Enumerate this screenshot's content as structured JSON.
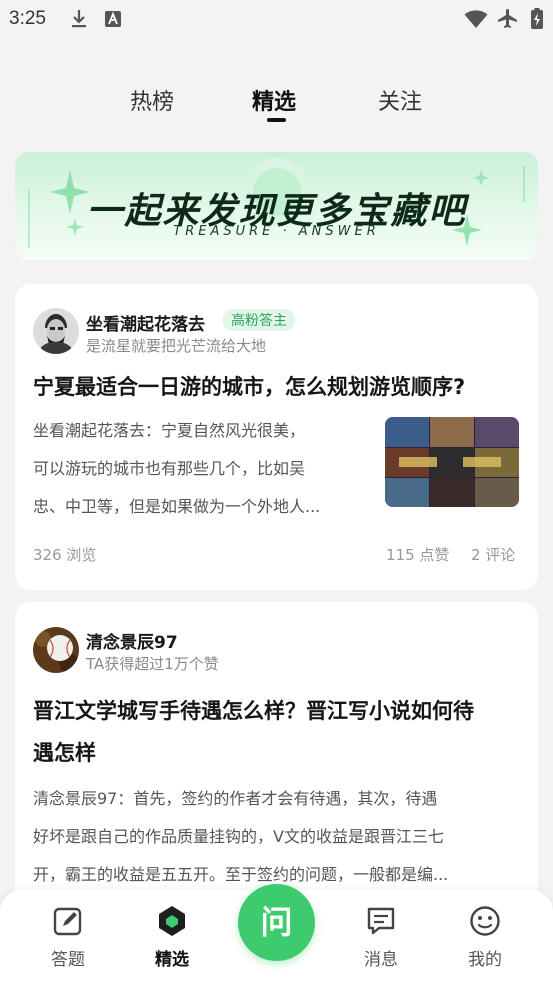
{
  "status_bar": {
    "time": "3:25"
  },
  "tabs": [
    {
      "label": "热榜"
    },
    {
      "label": "精选"
    },
    {
      "label": "关注"
    }
  ],
  "banner": {
    "title": "一起来发现更多宝藏吧",
    "subtitle": "TREASURE · ANSWER"
  },
  "cards": [
    {
      "author": "坐看潮起花落去",
      "badge": "高粉答主",
      "author_desc": "是流星就要把光芒流给大地",
      "title": "宁夏最适合一日游的城市，怎么规划游览顺序?",
      "excerpt_lines": [
        "坐看潮起花落去：宁夏自然风光很美，",
        "可以游玩的城市也有那些几个，比如吴",
        "忠、中卫等，但是如果做为一个外地人..."
      ],
      "views": "326 浏览",
      "likes": "115 点赞",
      "comments": "2 评论"
    },
    {
      "author": "清念景辰97",
      "author_desc": "TA获得超过1万个赞",
      "title_lines": [
        "晋江文学城写手待遇怎么样？晋江写小说如何待",
        "遇怎样"
      ],
      "excerpt_lines": [
        "清念景辰97：首先，签约的作者才会有待遇，其次，待遇",
        "好坏是跟自己的作品质量挂钩的，V文的收益是跟晋江三七",
        "开，霸王的收益是五五开。至于签约的问题，一般都是编..."
      ]
    }
  ],
  "bottom_nav": {
    "items": [
      {
        "label": "答题"
      },
      {
        "label": "精选"
      },
      {
        "label": "消息"
      },
      {
        "label": "我的"
      }
    ],
    "ask_label": "问"
  },
  "colors": {
    "accent": "#3ecb6e",
    "badge_text": "#27a659"
  }
}
